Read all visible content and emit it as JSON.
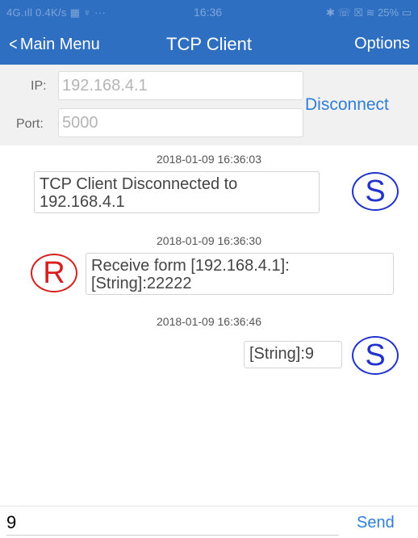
{
  "status_bar": {
    "left": "4G.ıll  0.4K/s ▦ ♆ ···",
    "time": "16:36",
    "right": "✱ ☏ ☒ ≋ 25% ▭"
  },
  "nav": {
    "back_label": "Main Menu",
    "title": "TCP Client",
    "options_label": "Options"
  },
  "connection": {
    "ip_label": "IP:",
    "ip_value": "192.168.4.1",
    "port_label": "Port:",
    "port_value": "5000",
    "disconnect_label": "Disconnect"
  },
  "messages": [
    {
      "timestamp": "2018-01-09 16:36:03",
      "badge": "S",
      "line1": "TCP Client Disconnected to",
      "line2": "192.168.4.1"
    },
    {
      "timestamp": "2018-01-09 16:36:30",
      "badge": "R",
      "line1": "Receive form [192.168.4.1]:",
      "line2": "[String]:22222"
    },
    {
      "timestamp": "2018-01-09 16:36:46",
      "badge": "S",
      "line1": "[String]:9"
    }
  ],
  "input": {
    "value": "9",
    "send_label": "Send"
  },
  "colors": {
    "header": "#2f6fc2",
    "link": "#2f7ed8",
    "sent_badge": "#2233cc",
    "received_badge": "#d81e1e"
  }
}
